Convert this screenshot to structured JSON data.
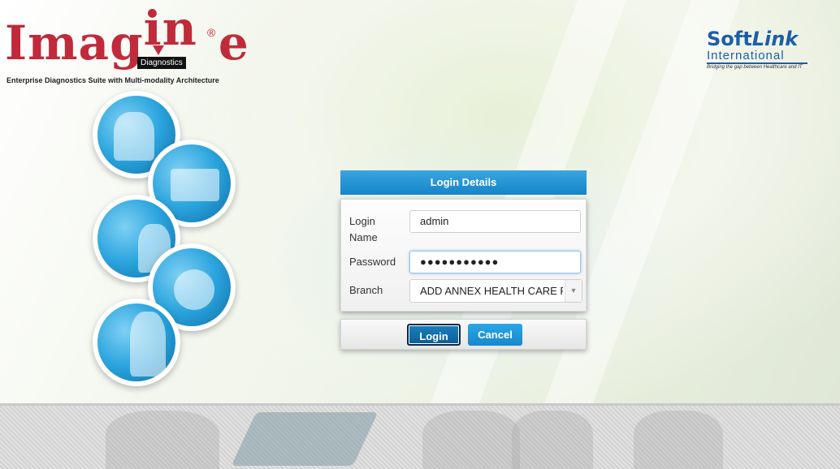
{
  "brand": {
    "logo_word_left": "Imag",
    "logo_word_in": "in",
    "logo_word_right": "e",
    "logo_registered": "®",
    "logo_sub": "Diagnostics",
    "tagline": "Enterprise Diagnostics Suite with Multi-modality Architecture"
  },
  "partner": {
    "name_soft": "Soft",
    "name_link": "Link",
    "name_intl": "International",
    "motto": "Bridging the gap between Healthcare and IT"
  },
  "login": {
    "header": "Login Details",
    "login_name_label": "Login Name",
    "login_name_value": "admin",
    "password_label": "Password",
    "password_value": "●●●●●●●●●●●",
    "branch_label": "Branch",
    "branch_value": "ADD ANNEX HEALTH CARE PVT.",
    "branch_arrow": "▼",
    "login_button": "Login",
    "cancel_button": "Cancel"
  }
}
